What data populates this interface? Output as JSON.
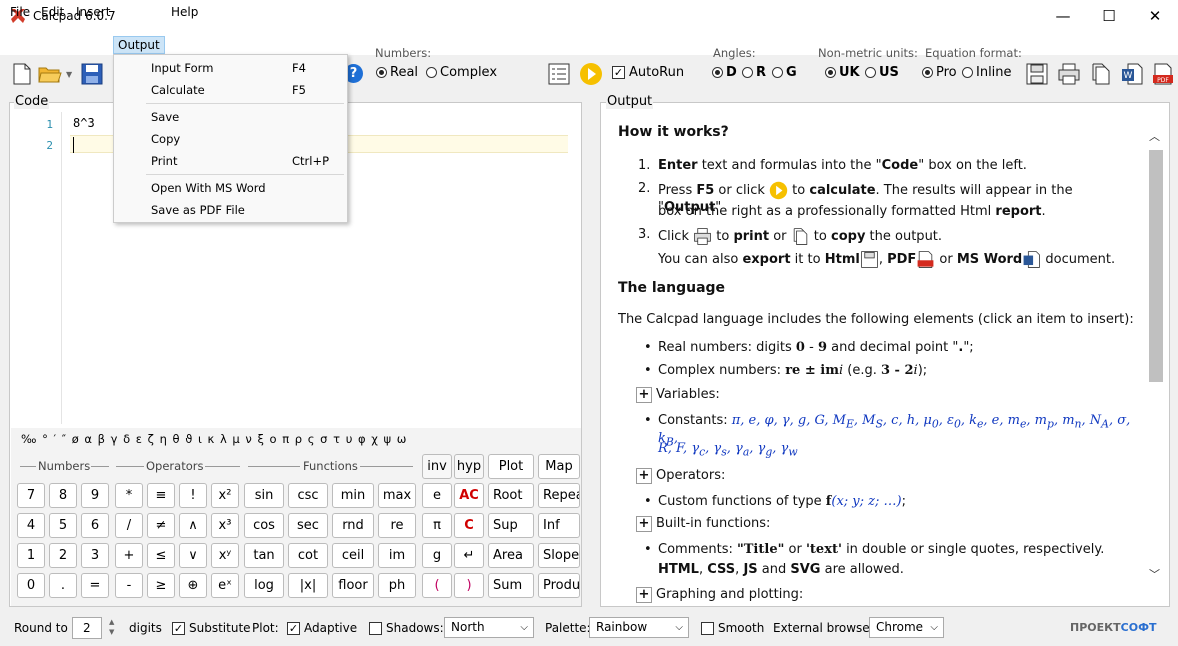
{
  "window": {
    "title": "Calcpad 6.0.7",
    "minimize": "—",
    "maximize": "☐",
    "close": "✕"
  },
  "menu": [
    "File",
    "Edit",
    "Insert",
    "Output",
    "Help"
  ],
  "output_menu": [
    {
      "label": "Input Form",
      "shortcut": "F4"
    },
    {
      "label": "Calculate",
      "shortcut": "F5"
    },
    {
      "label": "Save",
      "shortcut": ""
    },
    {
      "label": "Copy",
      "shortcut": ""
    },
    {
      "label": "Print",
      "shortcut": "Ctrl+P"
    },
    {
      "label": "Open With MS Word",
      "shortcut": ""
    },
    {
      "label": "Save as PDF File",
      "shortcut": ""
    }
  ],
  "toolbar": {
    "numbers_label": "Numbers:",
    "real": "Real",
    "complex": "Complex",
    "autorun": "AutoRun",
    "angles_label": "Angles:",
    "angle_d": "D",
    "angle_r": "R",
    "angle_g": "G",
    "units_label": "Non-metric units:",
    "uk": "UK",
    "us": "US",
    "eq_label": "Equation format:",
    "pro": "Pro",
    "inline": "Inline",
    "help": "?"
  },
  "code": {
    "label": "Code",
    "lines": [
      {
        "no": "1",
        "text": "8^3"
      },
      {
        "no": "2",
        "text": ""
      }
    ]
  },
  "greek": "‰ °  ′  ″  ø α β γ δ ε ζ η θ ϑ ι κ λ μ ν ξ ο π ρ ς σ τ υ φ χ ψ ω",
  "keyboard": {
    "sections": {
      "numbers": "Numbers",
      "operators": "Operators",
      "functions": "Functions"
    },
    "top": [
      "inv",
      "hyp",
      "Plot",
      "Map"
    ],
    "rows": [
      [
        "7",
        "8",
        "9",
        "*",
        "≡",
        "!",
        "x²",
        "sin",
        "csc",
        "min",
        "max",
        "e",
        "AC",
        "Root",
        "Repeat"
      ],
      [
        "4",
        "5",
        "6",
        "/",
        "≠",
        "∧",
        "x³",
        "cos",
        "sec",
        "rnd",
        "re",
        "π",
        "C",
        "Sup",
        "Inf"
      ],
      [
        "1",
        "2",
        "3",
        "+",
        "≤",
        "∨",
        "xʸ",
        "tan",
        "cot",
        "ceil",
        "im",
        "g",
        "↵",
        "Area",
        "Slope"
      ],
      [
        "0",
        ".",
        "=",
        "-",
        "≥",
        "⊕",
        "eˣ",
        "log",
        "|x|",
        "floor",
        "ph",
        "(",
        ")",
        "Sum",
        "Product"
      ]
    ]
  },
  "output": {
    "label": "Output",
    "how_title": "How it works?",
    "s1_a": "Enter",
    "s1_b": " text and formulas into the \"",
    "s1_c": "Code",
    "s1_d": "\" box on the left.",
    "s2_a": "Press ",
    "s2_b": "F5",
    "s2_c": " or click ",
    "s2_d": " to ",
    "s2_e": "calculate",
    "s2_f": ". The results will appear in the \"",
    "s2_g": "Output",
    "s2_h": "\"",
    "s2_i": "box on the right as a professionally formatted Html ",
    "s2_j": "report",
    "s2_k": ".",
    "s3_a": "Click ",
    "s3_b": " to ",
    "s3_c": "print",
    "s3_d": " or ",
    "s3_e": " to ",
    "s3_f": "copy",
    "s3_g": " the output.",
    "s3_h": "You can also ",
    "s3_i": "export",
    "s3_j": " it to ",
    "s3_k": "Html",
    "s3_l": ", ",
    "s3_m": "PDF",
    "s3_n": " or ",
    "s3_o": "MS Word",
    "s3_p": " document.",
    "lang_title": "The language",
    "lang_intro": "The Calcpad language includes the following elements (click an item to insert):",
    "real_a": "Real numbers: digits ",
    "real_b": "0",
    "real_c": " - ",
    "real_d": "9",
    "real_e": " and decimal point \"",
    "real_f": ".",
    "real_g": "\";",
    "cplx_a": "Complex numbers: ",
    "cplx_b": "re ± im",
    "cplx_c": "i",
    "cplx_d": " (e.g. ",
    "cplx_e": "3 - 2",
    "cplx_f": "i",
    "cplx_g": ");",
    "variables": "Variables:",
    "const_a": "Constants: ",
    "const_b": "π, e, φ, γ, g, G, M",
    "const_b2": "E",
    "const_c": ", M",
    "const_c2": "S",
    "const_d": ", c, h, μ",
    "const_d2": "0",
    "const_e": ", ε",
    "const_e2": "0",
    "const_f": ", k",
    "const_f2": "e",
    "const_g": ", e, m",
    "const_g2": "e",
    "const_h": ", m",
    "const_h2": "p",
    "const_i": ", m",
    "const_i2": "n",
    "const_j": ", N",
    "const_j2": "A",
    "const_k": ", σ, k",
    "const_k2": "B",
    "const_l": ",",
    "const_m": "R, F, γ",
    "const_m2": "c",
    "const_n": ", γ",
    "const_n2": "s",
    "const_o": ", γ",
    "const_o2": "a",
    "const_p": ", γ",
    "const_p2": "g",
    "const_q": ", γ",
    "const_q2": "w",
    "operators": "Operators:",
    "custom_a": "Custom functions of type ",
    "custom_b": "f",
    "custom_c": "(x; y; z; …)",
    "custom_d": ";",
    "builtin": "Built-in functions:",
    "comm_a": "Comments: ",
    "comm_b": "\"Title\"",
    "comm_c": " or ",
    "comm_d": "'text'",
    "comm_e": " in double or single quotes, respectively.",
    "comm_f": "HTML",
    "comm_g": ", ",
    "comm_h": "CSS",
    "comm_i": ", ",
    "comm_j": "JS",
    "comm_k": " and ",
    "comm_l": "SVG",
    "comm_m": " are allowed.",
    "graph": "Graphing and plotting:",
    "plus": "+"
  },
  "status": {
    "round_label": "Round to",
    "round_value": "2",
    "digits": "digits",
    "substitute": "Substitute",
    "plot_label": "Plot:",
    "adaptive": "Adaptive",
    "shadows_label": "Shadows:",
    "shadows_value": "North",
    "palette_label": "Palette:",
    "palette_value": "Rainbow",
    "smooth": "Smooth",
    "browser_label": "External browser:",
    "browser_value": "Chrome",
    "brand_a": "ПРОЕКТ",
    "brand_b": "СОФТ"
  }
}
